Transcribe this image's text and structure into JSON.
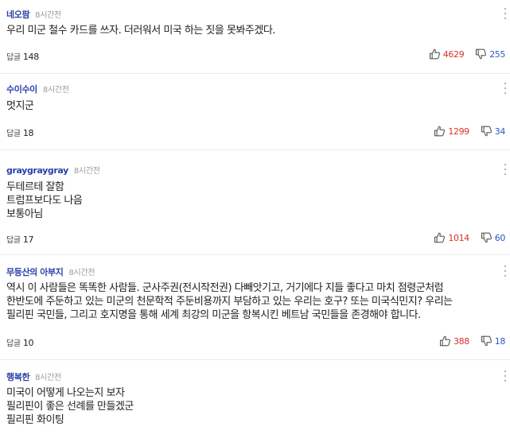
{
  "reply_label": "답글",
  "colors": {
    "author": "#2a3fa8",
    "like": "#d6332a",
    "dislike": "#2c57c9"
  },
  "icons": {
    "like": "thumbs-up-icon",
    "dislike": "thumbs-down-icon",
    "more": "more-vertical-icon"
  },
  "comments": [
    {
      "author": "네오팜",
      "time": "8시간전",
      "lines": [
        "우리 미군 철수 카드를 쓰자. 더러워서 미국 하는 짓을 못봐주겠다."
      ],
      "replies": "148",
      "likes": "4629",
      "dislikes": "255"
    },
    {
      "author": "수이수이",
      "time": "8시간전",
      "lines": [
        "멋지군"
      ],
      "replies": "18",
      "likes": "1299",
      "dislikes": "34"
    },
    {
      "author": "graygraygray",
      "time": "8시간전",
      "lines": [
        "두테르테 잘함",
        "트럼프보다도 나음",
        "보통아님"
      ],
      "replies": "17",
      "likes": "1014",
      "dislikes": "60"
    },
    {
      "author": "무등산의 아부지",
      "time": "8시간전",
      "lines": [
        "역시 이 사람들은 똑똑한 사람들. 군사주권(전시작전권) 다빼앗기고, 거기에다 지들 좋다고 마치 점령군처럼",
        "한반도에 주둔하고 있는 미군의 천문학적 주둔비용까지 부담하고 있는 우리는 호구? 또는 미국식민지? 우리는",
        "필리핀 국민들, 그리고 호지명을 통해 세계 최강의 미군을 항복시킨 베트남 국민들을 존경해야 합니다."
      ],
      "replies": "10",
      "likes": "388",
      "dislikes": "18"
    },
    {
      "author": "행복한",
      "time": "8시간전",
      "lines": [
        "미국이 어떻게 나오는지 보자",
        "필리핀이 좋은 선례를 만들겠군",
        "필리핀 화이팅"
      ]
    }
  ]
}
